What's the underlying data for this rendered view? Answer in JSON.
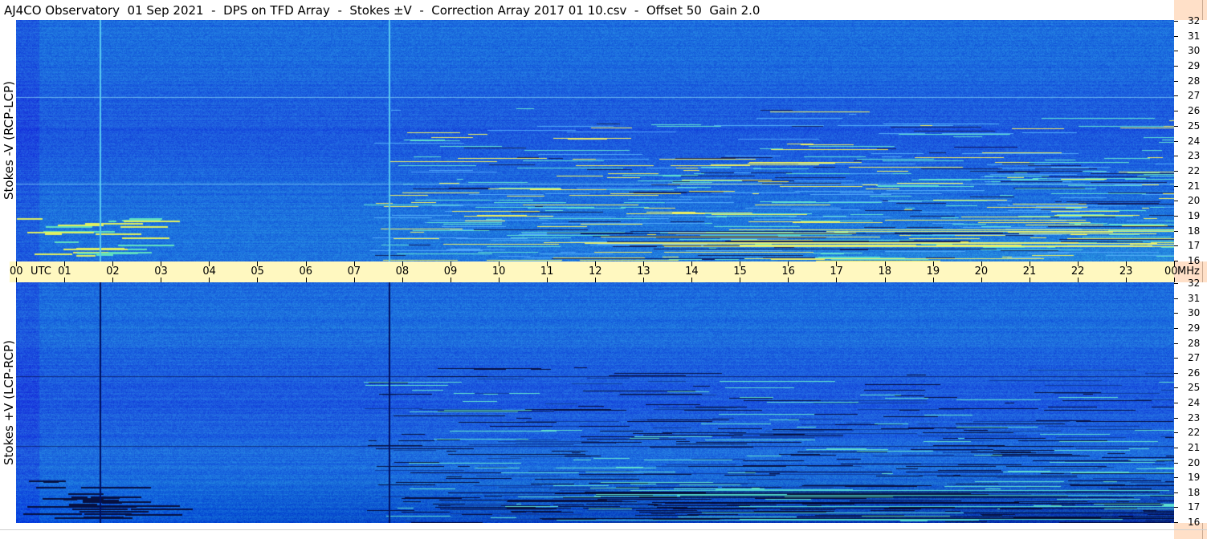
{
  "title": "AJ4CO Observatory  01 Sep 2021  -  DPS on TFD Array  -  Stokes ±V  -  Correction Array 2017 01 10.csv  -  Offset 50  Gain 2.0",
  "chart_data": [
    {
      "type": "heatmap",
      "name": "stokes-minus-v",
      "ylabel": "Stokes -V (RCP-LCP)",
      "x_ticks": [
        "00",
        "01",
        "02",
        "03",
        "04",
        "05",
        "06",
        "07",
        "08",
        "09",
        "10",
        "11",
        "12",
        "13",
        "14",
        "15",
        "16",
        "17",
        "18",
        "19",
        "20",
        "21",
        "22",
        "23",
        "00"
      ],
      "x_range_hours": [
        0,
        24
      ],
      "y_ticks": [
        32,
        31,
        30,
        29,
        28,
        27,
        26,
        25,
        24,
        23,
        22,
        21,
        20,
        19,
        18,
        17,
        16
      ],
      "ylim": [
        16,
        32
      ],
      "base_color": "#1f66e0",
      "artifact_lines_hours": [
        1.73,
        7.73
      ],
      "artifact_color": "#58c8f0"
    },
    {
      "type": "heatmap",
      "name": "stokes-plus-v",
      "ylabel": "Stokes +V (LCP-RCP)",
      "x_ticks": [
        "00",
        "01",
        "02",
        "03",
        "04",
        "05",
        "06",
        "07",
        "08",
        "09",
        "10",
        "11",
        "12",
        "13",
        "14",
        "15",
        "16",
        "17",
        "18",
        "19",
        "20",
        "21",
        "22",
        "23",
        "00"
      ],
      "x_range_hours": [
        0,
        24
      ],
      "y_ticks": [
        32,
        31,
        30,
        29,
        28,
        27,
        26,
        25,
        24,
        23,
        22,
        21,
        20,
        19,
        18,
        17,
        16
      ],
      "ylim": [
        16,
        32
      ],
      "base_color": "#1f66e0",
      "artifact_lines_hours": [
        1.73,
        7.73
      ],
      "artifact_color": "#001060"
    }
  ],
  "time_axis": {
    "labels": [
      "00",
      "01",
      "02",
      "03",
      "04",
      "05",
      "06",
      "07",
      "08",
      "09",
      "10",
      "11",
      "12",
      "13",
      "14",
      "15",
      "16",
      "17",
      "18",
      "19",
      "20",
      "21",
      "22",
      "23",
      "00"
    ],
    "utc_label": "UTC",
    "mhz_label": "MHz"
  },
  "colors": {
    "axis_bg": "#fff8c0",
    "right_strip": "#ffe0c8"
  }
}
